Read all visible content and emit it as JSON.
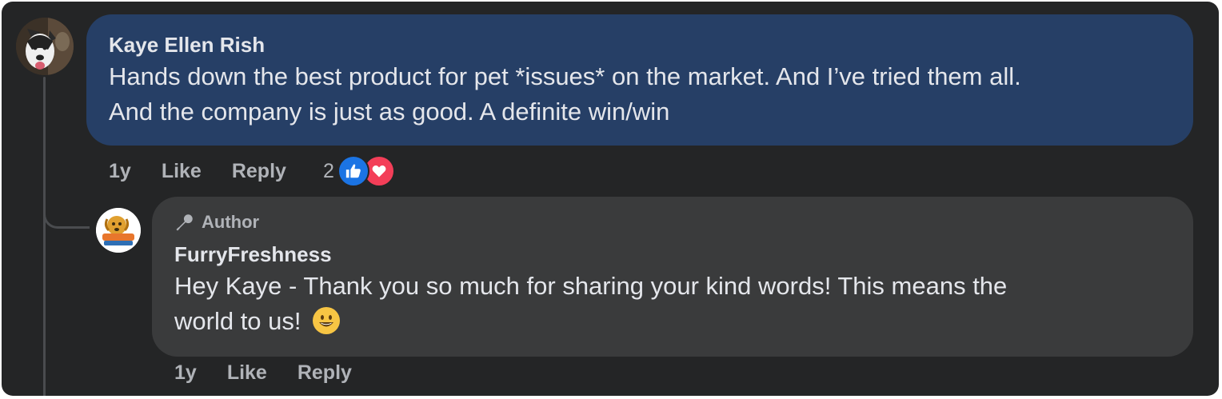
{
  "main_comment": {
    "author": "Kaye Ellen Rish",
    "text_line1": "Hands down the best product for pet *issues* on the market. And I’ve tried them all.",
    "text_line2": "And the company is just as good. A definite win/win",
    "time": "1y",
    "like_label": "Like",
    "reply_label": "Reply",
    "reaction_count": "2",
    "reaction_icons": [
      "like-icon",
      "love-icon"
    ]
  },
  "reply_comment": {
    "badge": "Author",
    "author": "FurryFreshness",
    "text_line1": "Hey Kaye - Thank you so much for sharing your kind words! This means the",
    "text_line2": "world to us!",
    "emoji": "grinning-face-icon",
    "time": "1y",
    "like_label": "Like",
    "reply_label": "Reply"
  },
  "colors": {
    "background": "#242526",
    "main_bubble": "#263f66",
    "reply_bubble": "#3a3b3c",
    "text_primary": "#e4e6eb",
    "text_secondary": "#b0b3b8",
    "like_blue": "#1b74e4",
    "love_red": "#f33e58"
  }
}
